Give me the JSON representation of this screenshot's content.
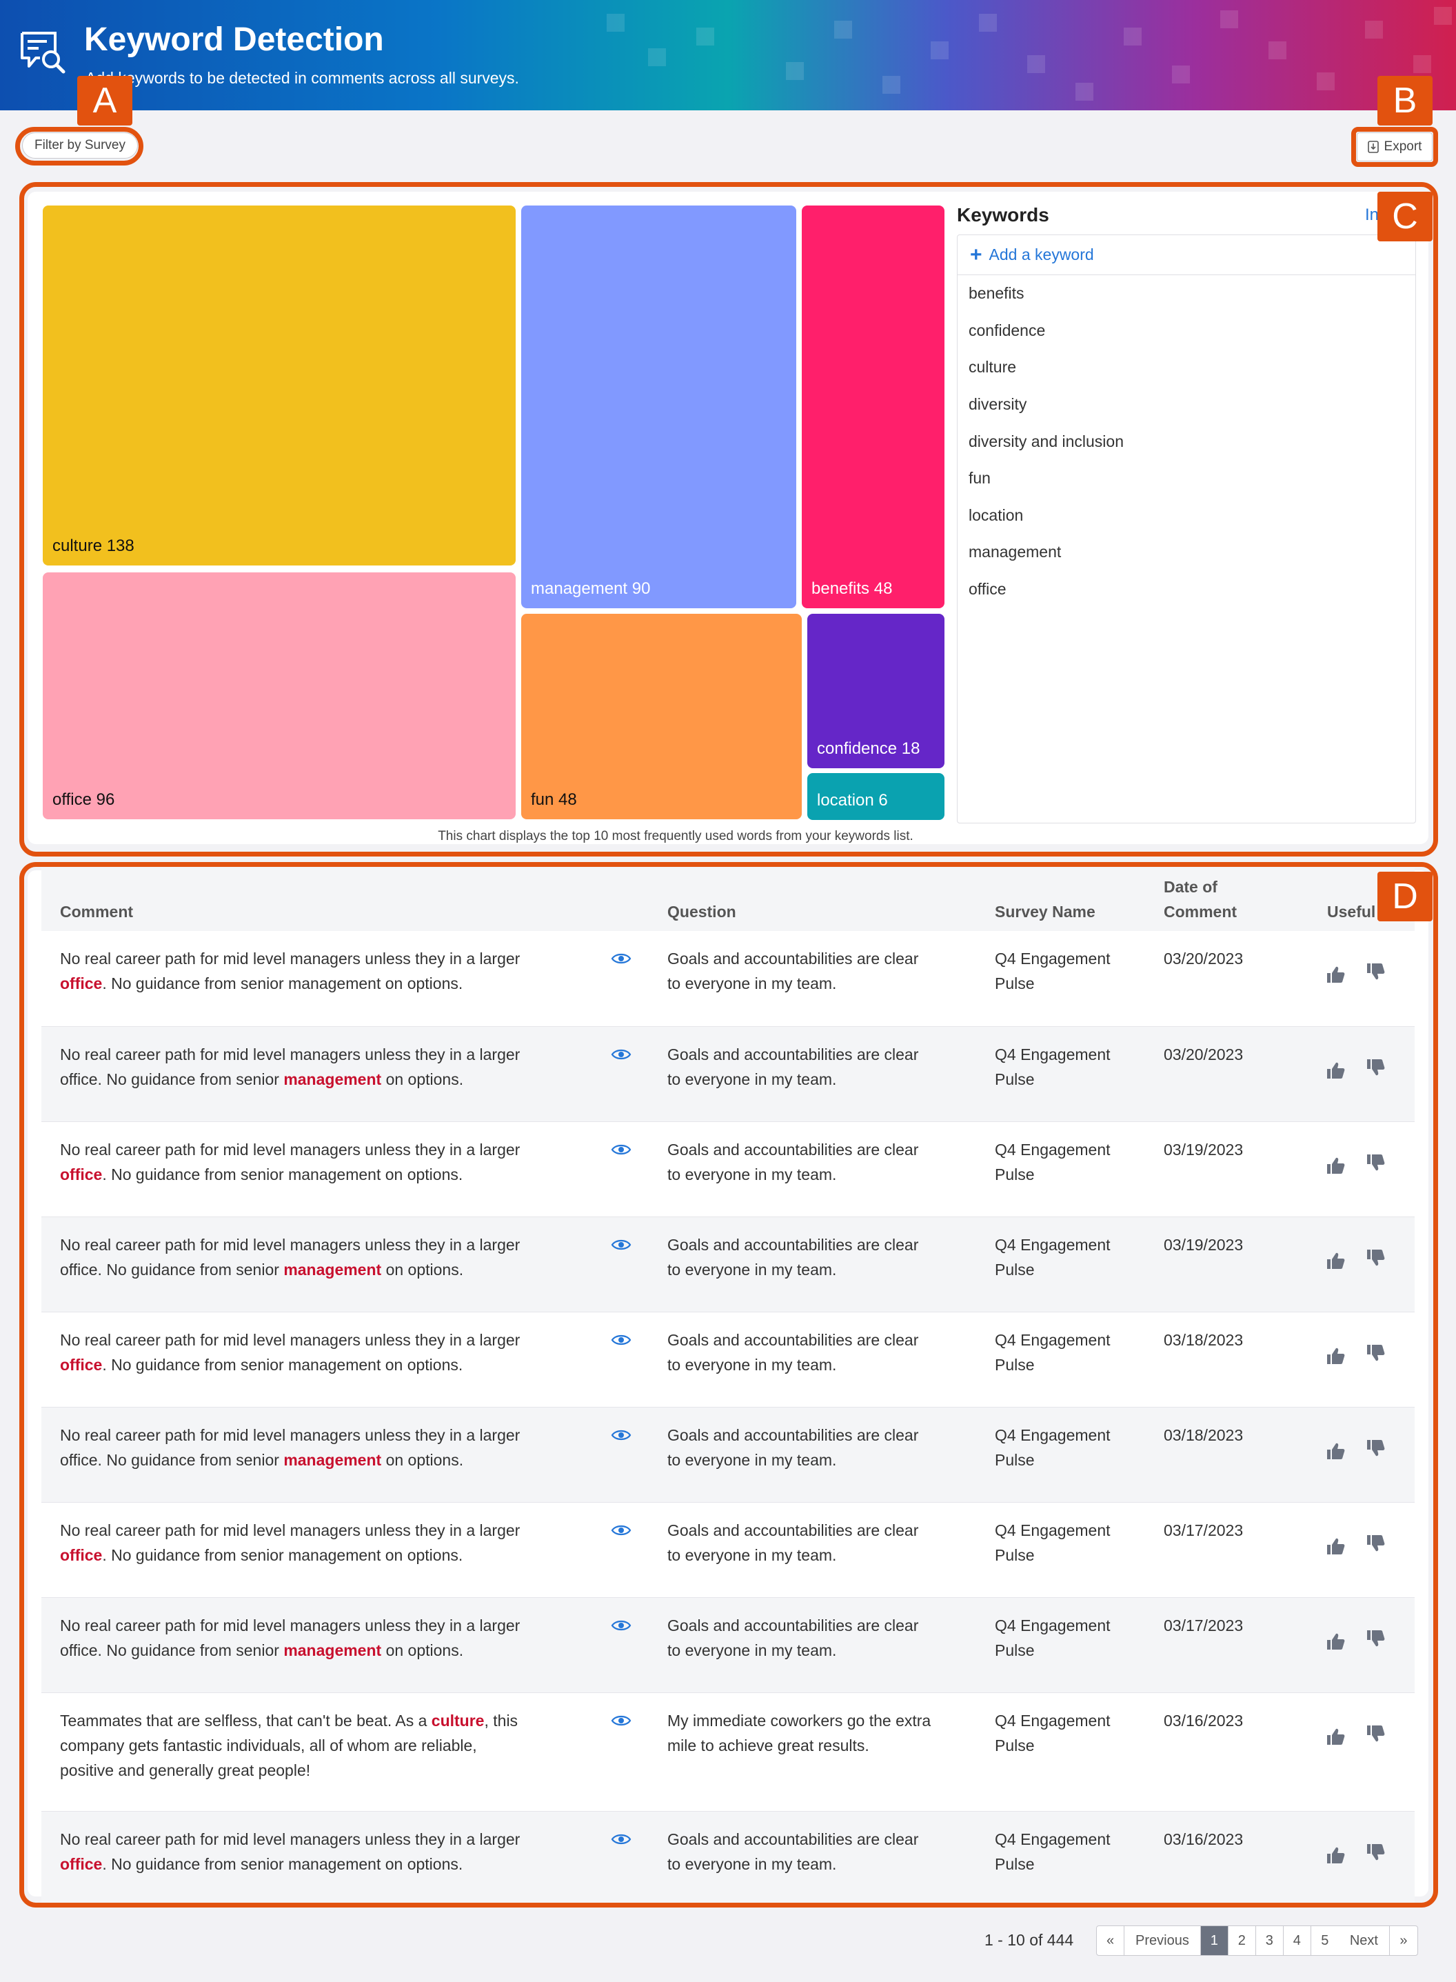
{
  "header": {
    "title": "Keyword Detection",
    "subtitle": "Add keywords to be detected in comments across all surveys."
  },
  "toolbar": {
    "filter_label": "Filter by Survey",
    "export_label": "Export"
  },
  "callouts": [
    "A",
    "B",
    "C",
    "D"
  ],
  "colors": {
    "accent": "#e2520f",
    "link": "#2476d8",
    "keyword_highlight": "#c8102e",
    "pager_active": "#6b7280"
  },
  "chart_data": {
    "type": "treemap",
    "items": [
      {
        "label": "culture",
        "value": 138,
        "color": "#f2c01e"
      },
      {
        "label": "office",
        "value": 96,
        "color": "#ffa2b4"
      },
      {
        "label": "management",
        "value": 90,
        "color": "#8199ff"
      },
      {
        "label": "fun",
        "value": 48,
        "color": "#ff9747"
      },
      {
        "label": "benefits",
        "value": 48,
        "color": "#ff1f6b"
      },
      {
        "label": "confidence",
        "value": 18,
        "color": "#6526c8"
      },
      {
        "label": "location",
        "value": 6,
        "color": "#0aa2b0"
      }
    ],
    "note": "This chart displays the top 10 most frequently used words from your keywords list."
  },
  "keywords": {
    "title": "Keywords",
    "intro_fragment": "In",
    "add_label": "Add a keyword",
    "items": [
      "benefits",
      "confidence",
      "culture",
      "diversity",
      "diversity and inclusion",
      "fun",
      "location",
      "management",
      "office"
    ]
  },
  "table": {
    "headers": {
      "comment": "Comment",
      "question": "Question",
      "survey": "Survey Name",
      "date_line1": "Date of",
      "date_line2": "Comment",
      "useful": "Useful"
    },
    "rows": [
      {
        "comment": [
          "No real career path for mid level managers unless they in a larger",
          "",
          "office",
          ". No guidance from senior management on options."
        ],
        "question": [
          "Goals and accountabilities are clear",
          "to everyone in my team."
        ],
        "survey": [
          "Q4 Engagement",
          "Pulse"
        ],
        "date": "03/20/2023"
      },
      {
        "comment": [
          "No real career path for mid level managers unless they in a larger",
          "office. No guidance from senior ",
          "management",
          " on options."
        ],
        "question": [
          "Goals and accountabilities are clear",
          "to everyone in my team."
        ],
        "survey": [
          "Q4 Engagement",
          "Pulse"
        ],
        "date": "03/20/2023"
      },
      {
        "comment": [
          "No real career path for mid level managers unless they in a larger",
          "",
          "office",
          ". No guidance from senior management on options."
        ],
        "question": [
          "Goals and accountabilities are clear",
          "to everyone in my team."
        ],
        "survey": [
          "Q4 Engagement",
          "Pulse"
        ],
        "date": "03/19/2023"
      },
      {
        "comment": [
          "No real career path for mid level managers unless they in a larger",
          "office. No guidance from senior ",
          "management",
          " on options."
        ],
        "question": [
          "Goals and accountabilities are clear",
          "to everyone in my team."
        ],
        "survey": [
          "Q4 Engagement",
          "Pulse"
        ],
        "date": "03/19/2023"
      },
      {
        "comment": [
          "No real career path for mid level managers unless they in a larger",
          "",
          "office",
          ". No guidance from senior management on options."
        ],
        "question": [
          "Goals and accountabilities are clear",
          "to everyone in my team."
        ],
        "survey": [
          "Q4 Engagement",
          "Pulse"
        ],
        "date": "03/18/2023"
      },
      {
        "comment": [
          "No real career path for mid level managers unless they in a larger",
          "office. No guidance from senior ",
          "management",
          " on options."
        ],
        "question": [
          "Goals and accountabilities are clear",
          "to everyone in my team."
        ],
        "survey": [
          "Q4 Engagement",
          "Pulse"
        ],
        "date": "03/18/2023"
      },
      {
        "comment": [
          "No real career path for mid level managers unless they in a larger",
          "",
          "office",
          ". No guidance from senior management on options."
        ],
        "question": [
          "Goals and accountabilities are clear",
          "to everyone in my team."
        ],
        "survey": [
          "Q4 Engagement",
          "Pulse"
        ],
        "date": "03/17/2023"
      },
      {
        "comment": [
          "No real career path for mid level managers unless they in a larger",
          "office. No guidance from senior ",
          "management",
          " on options."
        ],
        "question": [
          "Goals and accountabilities are clear",
          "to everyone in my team."
        ],
        "survey": [
          "Q4 Engagement",
          "Pulse"
        ],
        "date": "03/17/2023"
      },
      {
        "comment": [
          "Teammates that are selfless, that can't be beat. As a ",
          "culture",
          ", this",
          "company gets fantastic individuals, all of whom are reliable,",
          "positive and generally great people!"
        ],
        "question": [
          "My immediate coworkers go the extra",
          "mile to achieve great results."
        ],
        "survey": [
          "Q4 Engagement",
          "Pulse"
        ],
        "date": "03/16/2023"
      },
      {
        "comment": [
          "No real career path for mid level managers unless they in a larger",
          "",
          "office",
          ". No guidance from senior management on options."
        ],
        "question": [
          "Goals and accountabilities are clear",
          "to everyone in my team."
        ],
        "survey": [
          "Q4 Engagement",
          "Pulse"
        ],
        "date": "03/16/2023"
      }
    ]
  },
  "pagination": {
    "summary": "1 - 10 of 444",
    "first": "«",
    "previous": "Previous",
    "pages": [
      "1",
      "2",
      "3",
      "4",
      "5"
    ],
    "next": "Next",
    "last": "»",
    "current": "1"
  }
}
